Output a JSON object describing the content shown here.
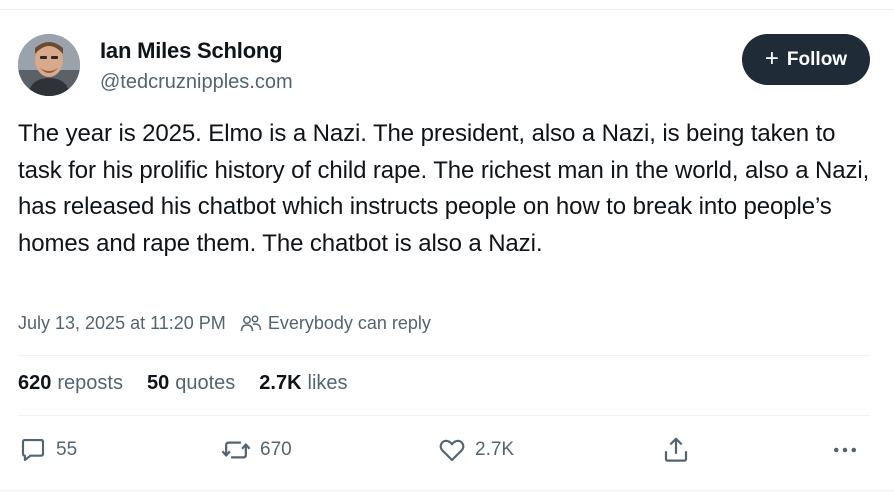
{
  "author": {
    "display_name": "Ian Miles Schlong",
    "handle": "@tedcruznipples.com"
  },
  "follow_button": {
    "icon": "plus-icon",
    "label": "Follow"
  },
  "post": {
    "text": "The year is 2025. Elmo is a Nazi. The president, also a Nazi, is being taken to task for his prolific history of child rape. The richest man in the world, also a Nazi, has released his chatbot which instructs people on how to break into people’s homes and rape them. The chatbot is also a Nazi.",
    "timestamp": "July 13, 2025 at 11:20 PM",
    "reply_setting": "Everybody can reply"
  },
  "stats": {
    "reposts_count": "620",
    "reposts_label": "reposts",
    "quotes_count": "50",
    "quotes_label": "quotes",
    "likes_count": "2.7K",
    "likes_label": "likes"
  },
  "actions": {
    "replies": "55",
    "reposts": "670",
    "likes": "2.7K"
  },
  "colors": {
    "text_primary": "#0f1419",
    "text_secondary": "#536471",
    "follow_button_bg": "#1f2b36",
    "divider": "#eff3f4"
  }
}
